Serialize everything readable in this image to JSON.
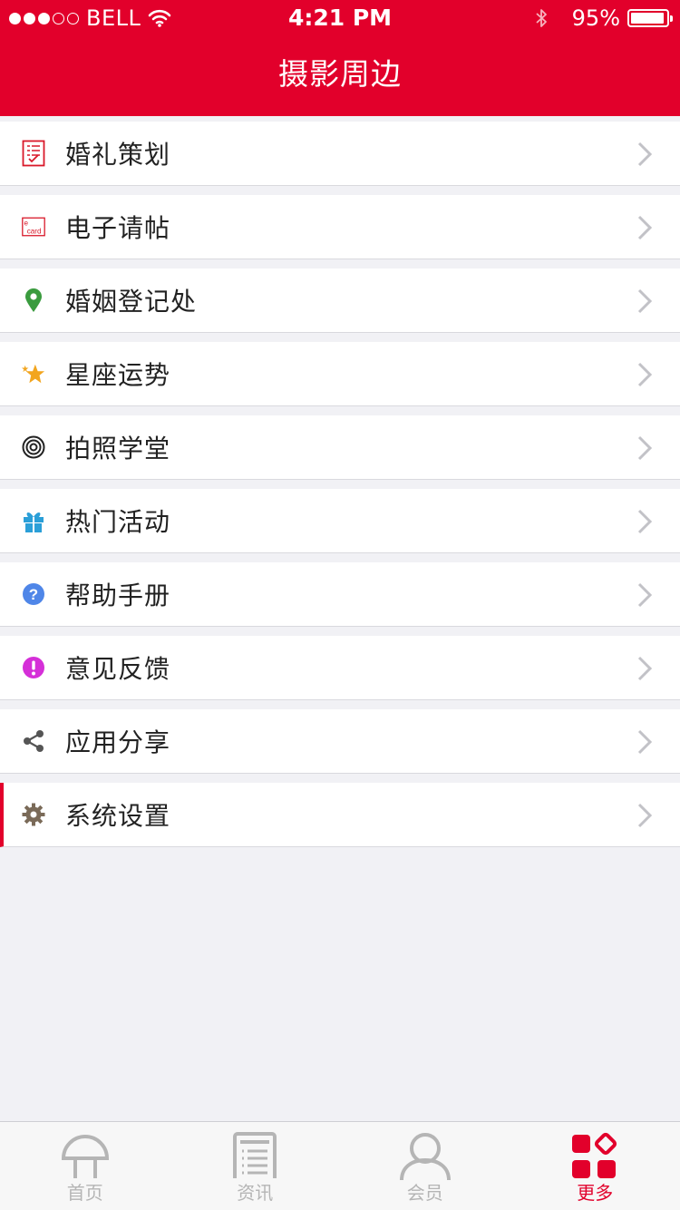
{
  "status_bar": {
    "carrier": "BELL",
    "time": "4:21 PM",
    "battery_percent": "95%",
    "battery_level": 0.95,
    "signal_strength": 3
  },
  "header": {
    "title": "摄影周边"
  },
  "menu": {
    "items": [
      {
        "label": "婚礼策划",
        "icon": "checklist-icon",
        "color": "#d9192a"
      },
      {
        "label": "电子请帖",
        "icon": "ecard-icon",
        "color": "#d9192a",
        "icon_text_top": "e",
        "icon_text_bottom": "card"
      },
      {
        "label": "婚姻登记处",
        "icon": "map-pin-icon",
        "color": "#3a9b3e"
      },
      {
        "label": "星座运势",
        "icon": "star-icon",
        "color": "#f2a51f"
      },
      {
        "label": "拍照学堂",
        "icon": "target-icon",
        "color": "#222222"
      },
      {
        "label": "热门活动",
        "icon": "gift-icon",
        "color": "#2b9fd8"
      },
      {
        "label": "帮助手册",
        "icon": "help-icon",
        "color": "#4f86e8"
      },
      {
        "label": "意见反馈",
        "icon": "exclamation-icon",
        "color": "#d52fd8"
      },
      {
        "label": "应用分享",
        "icon": "share-icon",
        "color": "#555555"
      },
      {
        "label": "系统设置",
        "icon": "gear-icon",
        "color": "#7a6a58"
      }
    ]
  },
  "tabbar": {
    "tabs": [
      {
        "label": "首页",
        "icon": "home-icon"
      },
      {
        "label": "资讯",
        "icon": "news-icon"
      },
      {
        "label": "会员",
        "icon": "user-icon"
      },
      {
        "label": "更多",
        "icon": "more-icon"
      }
    ],
    "active_index": 3,
    "active_color": "#e2002b",
    "inactive_color": "#b5b5b5"
  },
  "colors": {
    "brand_red": "#e2002b",
    "background": "#f1f1f5"
  }
}
